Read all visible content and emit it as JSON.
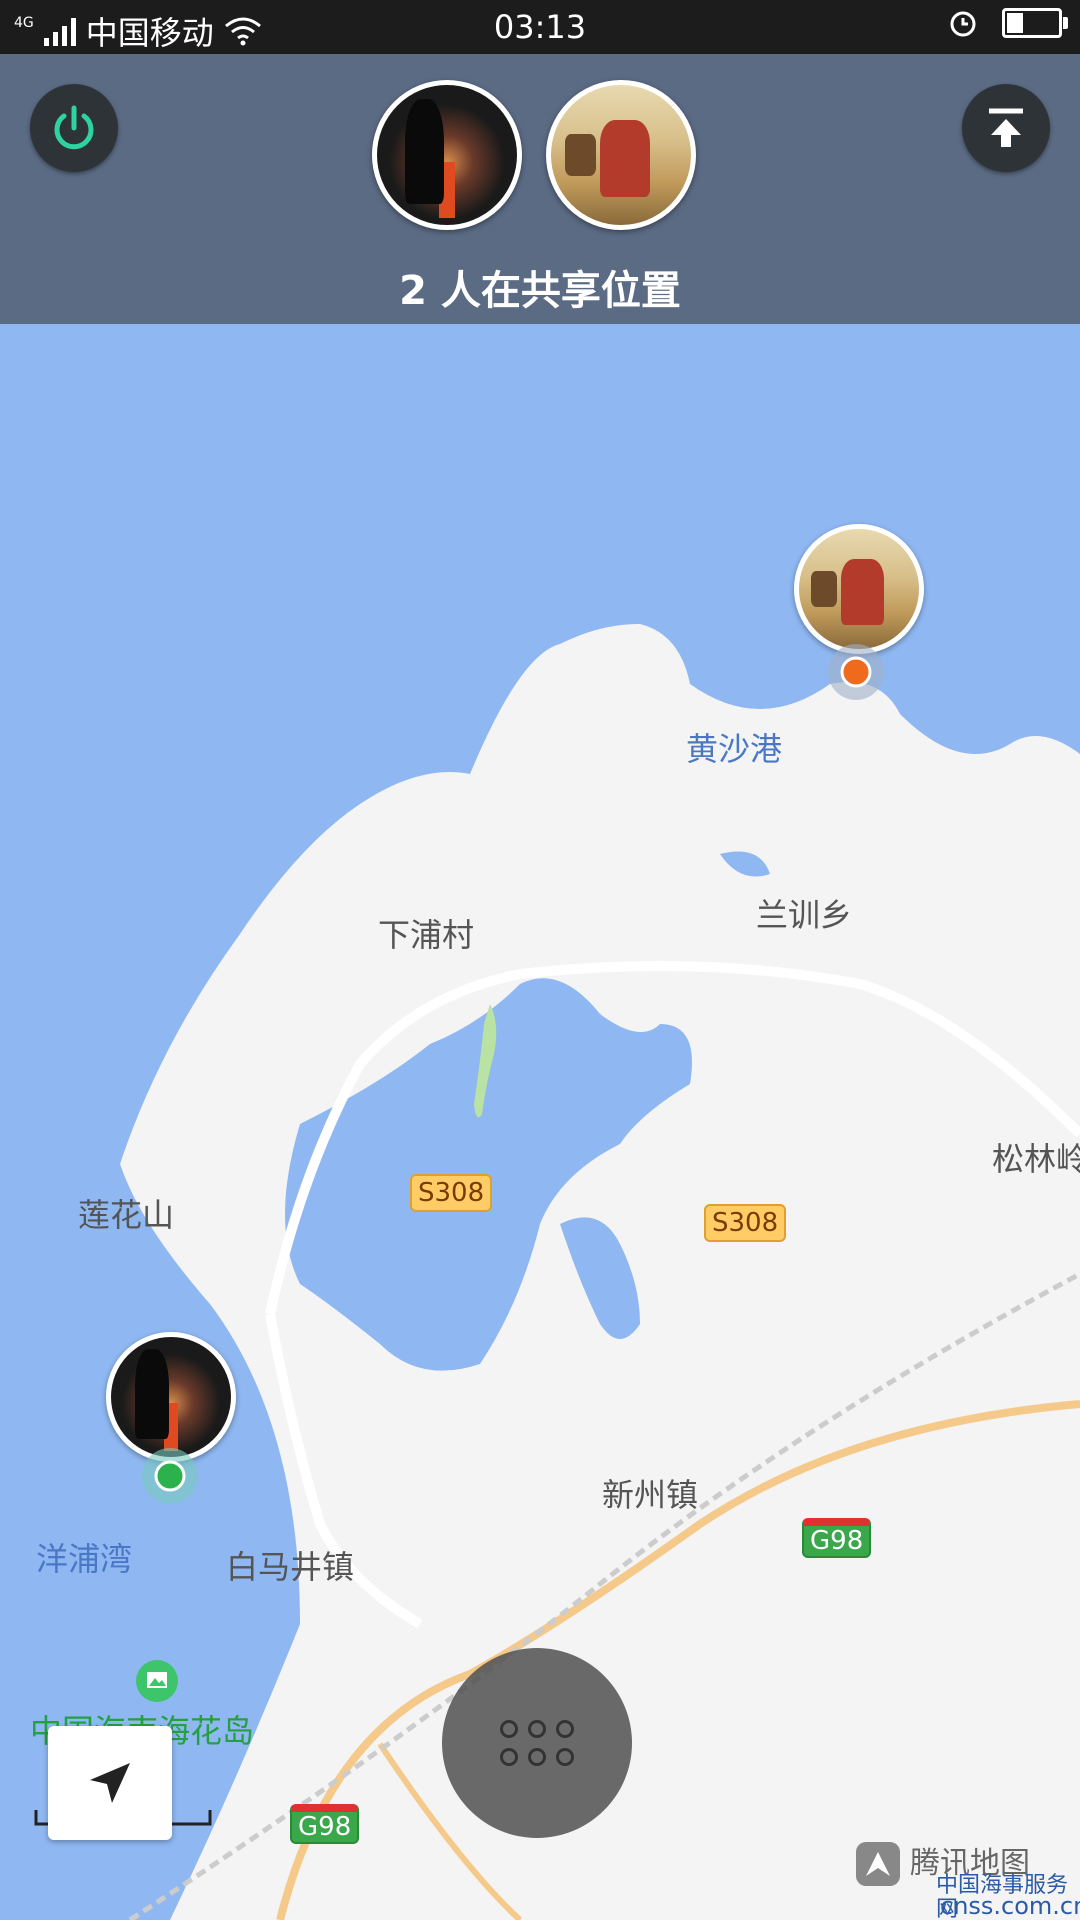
{
  "status_bar": {
    "network": "4G",
    "carrier": "中国移动",
    "time": "03:13",
    "battery_level": 0.3
  },
  "header": {
    "title": "2 人在共享位置",
    "accent_color": "#2ed3a0"
  },
  "map": {
    "places": {
      "huangshagang": "黄沙港",
      "lanxunxiang": "兰训乡",
      "xiapucun": "下浦村",
      "songlin": "松林岭",
      "lianhuashan": "莲花山",
      "xinzhouzhen": "新州镇",
      "yangpuwan": "洋浦湾",
      "baimajingzhen": "白马井镇",
      "haihuadao": "中国海南海花岛"
    },
    "roads": {
      "s308_a": "S308",
      "s308_b": "S308",
      "g98_a": "G98",
      "g98_b": "G98"
    },
    "scale": "5km"
  },
  "brand": {
    "name": "腾讯地图",
    "watermark_cn": "中国海事服务网",
    "watermark_url": "cnss.com.cn"
  }
}
